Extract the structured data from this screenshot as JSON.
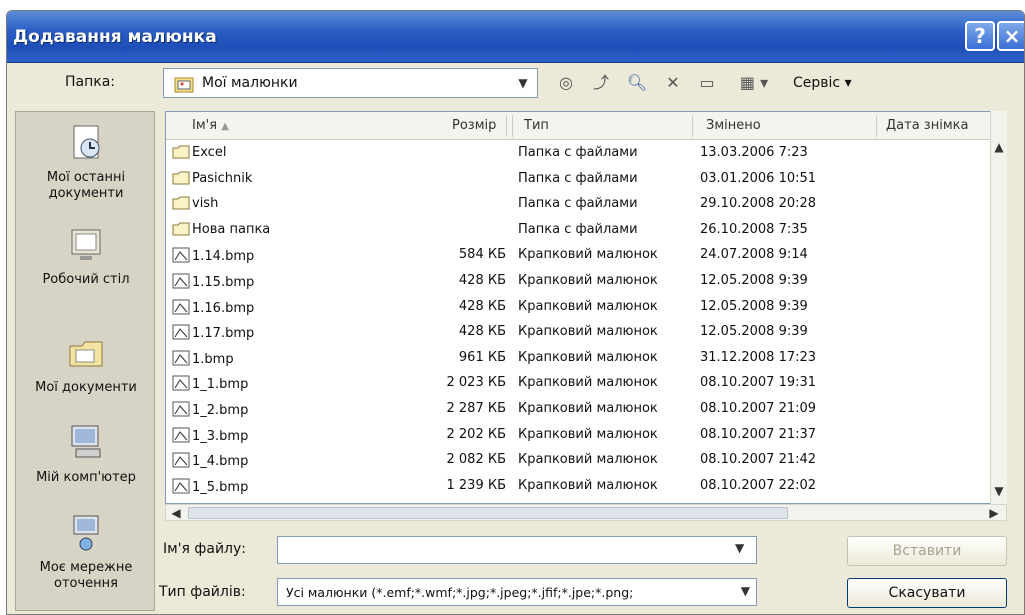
{
  "window": {
    "title": "Додавання малюнка",
    "help": "?",
    "close": "×"
  },
  "toolbar": {
    "folder_label": "Папка:",
    "folder_value": "Мої малюнки",
    "tools_label": "Сервіс ▾"
  },
  "places": [
    {
      "label": "Мої останні документи",
      "icon": "recent-documents-icon"
    },
    {
      "label": "Робочий стіл",
      "icon": "desktop-icon"
    },
    {
      "label": "Мої документи",
      "icon": "my-documents-icon"
    },
    {
      "label": "Мій комп'ютер",
      "icon": "my-computer-icon"
    },
    {
      "label": "Моє мережне оточення",
      "icon": "network-places-icon"
    }
  ],
  "columns": {
    "name": "Ім'я",
    "size": "Розмір",
    "type": "Тип",
    "modified": "Змінено",
    "taken": "Дата знімка"
  },
  "files": [
    {
      "name": "Excel",
      "size": "",
      "type": "Папка с файлами",
      "modified": "13.03.2006 7:23",
      "kind": "folder"
    },
    {
      "name": "Pasichnik",
      "size": "",
      "type": "Папка с файлами",
      "modified": "03.01.2006 10:51",
      "kind": "folder"
    },
    {
      "name": "vish",
      "size": "",
      "type": "Папка с файлами",
      "modified": "29.10.2008 20:28",
      "kind": "folder"
    },
    {
      "name": "Нова папка",
      "size": "",
      "type": "Папка с файлами",
      "modified": "26.10.2008 7:35",
      "kind": "folder"
    },
    {
      "name": "1.14.bmp",
      "size": "584 КБ",
      "type": "Крапковий малюнок",
      "modified": "24.07.2008 9:14",
      "kind": "image"
    },
    {
      "name": "1.15.bmp",
      "size": "428 КБ",
      "type": "Крапковий малюнок",
      "modified": "12.05.2008 9:39",
      "kind": "image"
    },
    {
      "name": "1.16.bmp",
      "size": "428 КБ",
      "type": "Крапковий малюнок",
      "modified": "12.05.2008 9:39",
      "kind": "image"
    },
    {
      "name": "1.17.bmp",
      "size": "428 КБ",
      "type": "Крапковий малюнок",
      "modified": "12.05.2008 9:39",
      "kind": "image"
    },
    {
      "name": "1.bmp",
      "size": "961 КБ",
      "type": "Крапковий малюнок",
      "modified": "31.12.2008 17:23",
      "kind": "image"
    },
    {
      "name": "1_1.bmp",
      "size": "2 023 КБ",
      "type": "Крапковий малюнок",
      "modified": "08.10.2007 19:31",
      "kind": "image"
    },
    {
      "name": "1_2.bmp",
      "size": "2 287 КБ",
      "type": "Крапковий малюнок",
      "modified": "08.10.2007 21:09",
      "kind": "image"
    },
    {
      "name": "1_3.bmp",
      "size": "2 202 КБ",
      "type": "Крапковий малюнок",
      "modified": "08.10.2007 21:37",
      "kind": "image"
    },
    {
      "name": "1_4.bmp",
      "size": "2 082 КБ",
      "type": "Крапковий малюнок",
      "modified": "08.10.2007 21:42",
      "kind": "image"
    },
    {
      "name": "1_5.bmp",
      "size": "1 239 КБ",
      "type": "Крапковий малюнок",
      "modified": "08.10.2007 22:02",
      "kind": "image"
    }
  ],
  "bottom": {
    "filename_label": "Ім'я файлу:",
    "filename_value": "",
    "filetype_label": "Тип файлів:",
    "filetype_value": "Усі малюнки (*.emf;*.wmf;*.jpg;*.jpeg;*.jfif;*.jpe;*.png;",
    "insert_label": "Вставити",
    "cancel_label": "Скасувати"
  },
  "colors": {
    "titlebar": "#2a5cc4",
    "dialog_bg": "#ece9d8",
    "list_bg": "#ffffff"
  }
}
